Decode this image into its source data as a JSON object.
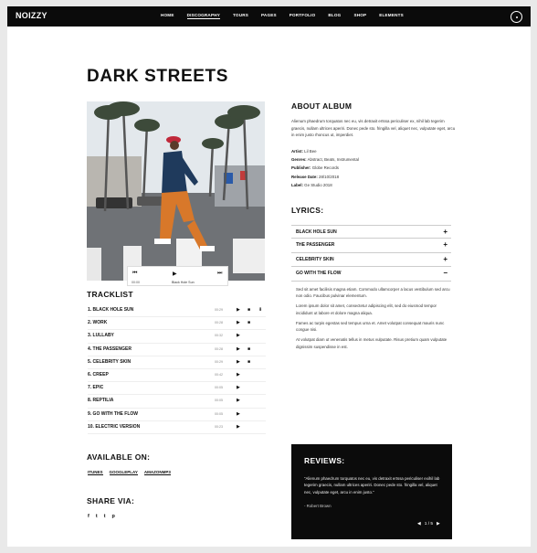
{
  "header": {
    "logo": "NOIZZY",
    "nav": [
      "HOME",
      "DISCOGRAPHY",
      "TOURS",
      "PAGES",
      "PORTFOLIO",
      "BLOG",
      "SHOP",
      "ELEMENTS"
    ],
    "active_nav": "DISCOGRAPHY"
  },
  "album": {
    "title": "DARK STREETS"
  },
  "player": {
    "time": "00:00",
    "now_playing": "Black Hole Sun"
  },
  "tracklist": {
    "heading": "TRACKLIST",
    "tracks": [
      {
        "name": "1. BLACK HOLE SUN",
        "duration": "00:29",
        "video": true,
        "download": true
      },
      {
        "name": "2. WORK",
        "duration": "00:28",
        "video": true,
        "download": false
      },
      {
        "name": "3. LULLABY",
        "duration": "00:32",
        "video": false,
        "download": false
      },
      {
        "name": "4. THE PASSENGER",
        "duration": "00:28",
        "video": true,
        "download": false
      },
      {
        "name": "5. CELEBRITY SKIN",
        "duration": "00:29",
        "video": true,
        "download": false
      },
      {
        "name": "6. CREEP",
        "duration": "00:42",
        "video": false,
        "download": false
      },
      {
        "name": "7. EPIC",
        "duration": "00:05",
        "video": false,
        "download": false
      },
      {
        "name": "8. REPTILIA",
        "duration": "00:05",
        "video": false,
        "download": false
      },
      {
        "name": "9. GO WITH THE FLOW",
        "duration": "00:05",
        "video": false,
        "download": false
      },
      {
        "name": "10. ELECTRIC VERSION",
        "duration": "00:23",
        "video": false,
        "download": false
      }
    ]
  },
  "available": {
    "heading": "AVAILABLE ON:",
    "stores": [
      "ITUNES",
      "GOOGLEPLAY",
      "AMAZONMP3"
    ]
  },
  "share": {
    "heading": "SHARE VIA:",
    "icons": [
      "f",
      "t",
      "t",
      "p"
    ]
  },
  "about": {
    "heading": "ABOUT ALBUM",
    "text": "Alienum phaedrum torquatos nec eu, vis detraxit ertssa periculiser ex, nihil lab tegerim graecis, nullam ultrices aperiri. Donec pede sto. fringilla vel, aliquet nec, vulputate eget, arcu in enim justo rhoncus ut, imperdiet.",
    "meta": [
      {
        "label": "Artist:",
        "value": "Lil Bee"
      },
      {
        "label": "Genres:",
        "value": "Abstract, Beats, Instrumental"
      },
      {
        "label": "Publisher:",
        "value": "Globe Records"
      },
      {
        "label": "Release Date:",
        "value": "28/10/2018"
      },
      {
        "label": "Label:",
        "value": "Ge Studio 2018"
      }
    ]
  },
  "lyrics": {
    "heading": "LYRICS:",
    "items": [
      {
        "label": "BLACK HOLE SUN",
        "sign": "+"
      },
      {
        "label": "THE PASSENGER",
        "sign": "+"
      },
      {
        "label": "CELEBRITY SKIN",
        "sign": "+"
      },
      {
        "label": "GO WITH THE FLOW",
        "sign": "−"
      }
    ],
    "stanzas": [
      "Sed sit amet facilisis magna etiam. Commodo ullamcorper a lacus vestibulum sed arcu non odio. Faucibus pulvinar elementum.",
      "Lorem ipsum dolor sit amet, consectetur adipiscing elit, sed do eiusmod tempor incididunt ut labore et dolore magna aliqua.",
      "Fames ac turpis egestas sed tempus urna et. Amet volutpat consequat mauris nunc congue nisi.",
      "At volutpat diam ut venenatis tellus in metus vulputate. Risus pretium quam vulputate dignissim suspendisse in est."
    ]
  },
  "reviews": {
    "heading": "REVIEWS:",
    "quote": "“Alienum phaedrum torquatos nec eu, vis detraxit ertssa periculiser exihil lab tegerim graecis, nullam ultrices aperiri. Donec pede sto. fringilla vel, aliquet nec, vulputate eget, arcu in enim justo.”",
    "author": "- Robert Brown",
    "page": "1 / 5"
  },
  "colors": {
    "header_bg": "#0b0b0b",
    "reviews_bg": "#0b0b0b",
    "accent": "#111111"
  }
}
